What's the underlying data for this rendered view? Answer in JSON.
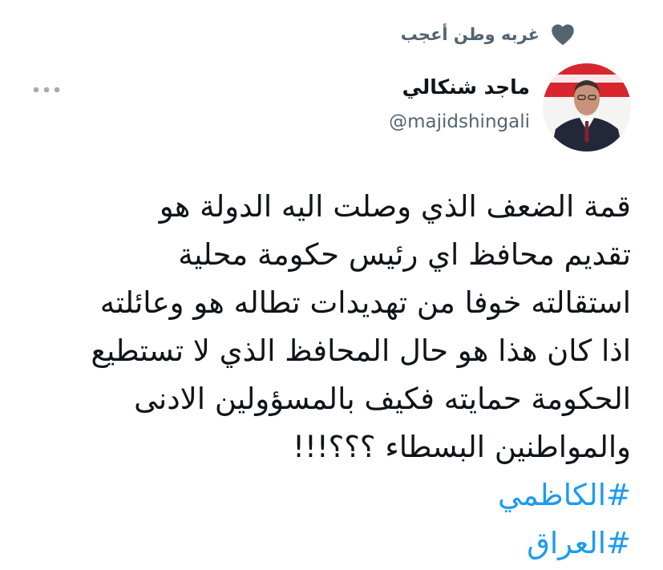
{
  "social_context": {
    "icon": "heart-icon",
    "text": "غربه وطن أعجب"
  },
  "author": {
    "display_name": "ماجد شنكالي",
    "handle": "@majidshingali",
    "avatar_icon": "avatar"
  },
  "more_icon": "more-icon",
  "tweet": {
    "lines": [
      "قمة الضعف الذي وصلت اليه الدولة هو",
      "تقديم محافظ اي رئيس حكومة محلية",
      "استقالته خوفا من تهديدات تطاله هو وعائلته",
      "اذا كان هذا هو حال المحافظ الذي لا تستطيع",
      "الحكومة حمايته فكيف بالمسؤولين الادنى",
      "والمواطنين البسطاء ؟؟؟!!!"
    ],
    "hashtags": [
      "#الكاظمي",
      "#العراق"
    ]
  },
  "colors": {
    "text": "#0f1419",
    "secondary": "#536471",
    "link": "#1d9bf0"
  }
}
